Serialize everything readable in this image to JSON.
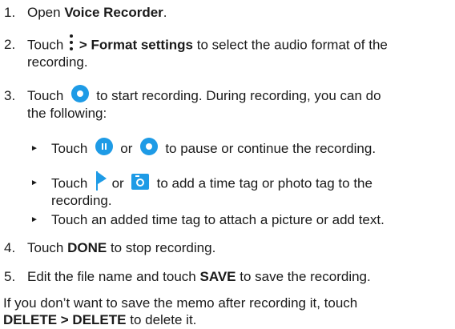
{
  "steps": [
    {
      "number": "1.",
      "pre": "Open ",
      "bold": "Voice Recorder",
      "post": "."
    },
    {
      "number": "2.",
      "pre": "Touch",
      "bold": "> Format settings",
      "post": " to select the audio format of the",
      "line2": "recording."
    },
    {
      "number": "3.",
      "pre": "Touch",
      "post": "to start recording. During recording, you can do",
      "line2": "the following:"
    },
    {
      "number": "4.",
      "pre": "Touch ",
      "bold": "DONE",
      "post": " to stop recording."
    },
    {
      "number": "5.",
      "pre": "Edit the file name and touch ",
      "bold": "SAVE",
      "post": " to save the recording."
    }
  ],
  "bullets": [
    {
      "pre": "Touch",
      "or": "or",
      "post": "to pause or continue the recording."
    },
    {
      "pre": "Touch",
      "or": "or",
      "post": "to add a time tag or photo tag to the",
      "line2": "recording."
    },
    {
      "text": "Touch an added time tag to attach a picture or add text."
    }
  ],
  "footer": {
    "line1": "If you don’t want to save the memo after recording it, touch",
    "bold": "DELETE > DELETE",
    "post": " to delete it."
  },
  "bullet_glyph": "►",
  "colors": {
    "icon_blue": "#1e9be6",
    "text": "#1a1a1a"
  },
  "icons": [
    "more-options-icon",
    "record-icon",
    "pause-icon",
    "flag-tag-icon",
    "camera-tag-icon"
  ]
}
